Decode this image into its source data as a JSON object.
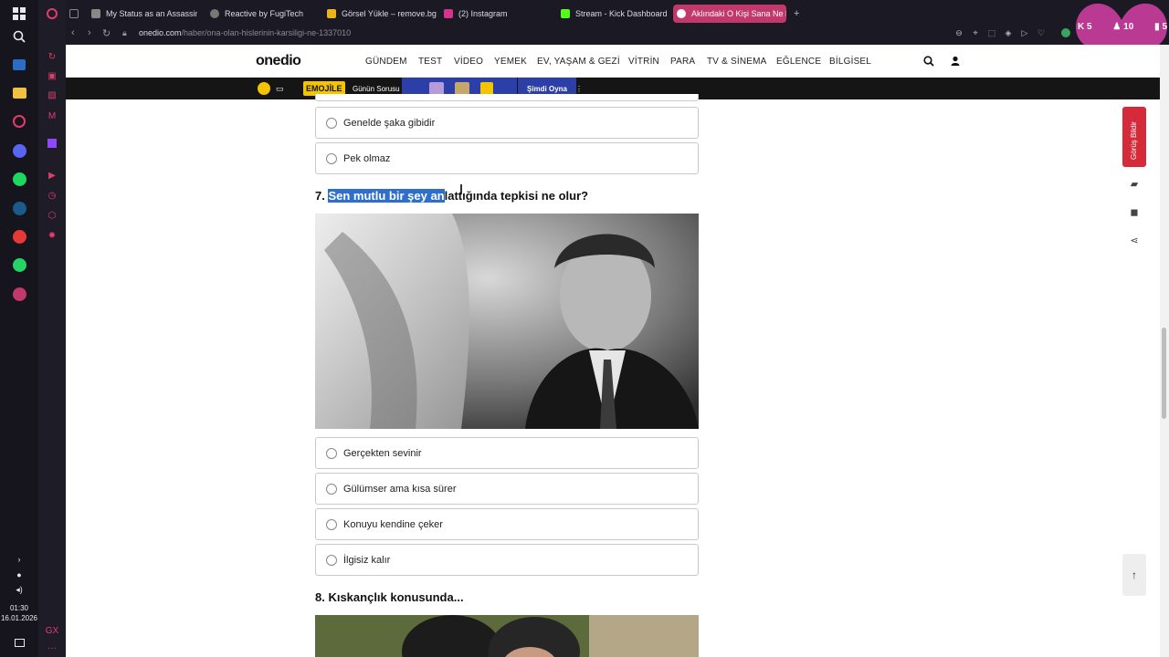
{
  "taskbar": {
    "time": "01:30",
    "date": "16.01.2026",
    "icons": [
      "windows-start",
      "search",
      "steam-shortcut",
      "file-explorer",
      "opera-gx",
      "discord",
      "spotify",
      "steam",
      "app-red",
      "whatsapp",
      "app-gx"
    ]
  },
  "tabs": [
    {
      "title": "My Status as an Assassin",
      "favicon_color": "#888888"
    },
    {
      "title": "Reactive by FugiTech",
      "favicon_color": "#777777"
    },
    {
      "title": "Görsel Yükle – remove.bg",
      "favicon_color": "#e8b31c"
    },
    {
      "title": "(2) Instagram",
      "favicon_color": "#d6338a"
    },
    {
      "title": "Stream - Kick Dashboard",
      "favicon_color": "#53fc18"
    },
    {
      "title": "Aklındaki O Kişi Sana Ne H",
      "favicon_color": "#c2386a",
      "active": true
    }
  ],
  "address": {
    "domain": "onedio.com",
    "path": "/haber/ona-olan-hislerinin-karsiligi-ne-1337010"
  },
  "overlay": {
    "kick_count": "5",
    "viewer_count": "10",
    "stat_count": "5",
    "heart_color": "#d63fa6"
  },
  "site": {
    "logo": "onedio",
    "nav": [
      "GÜNDEM",
      "TEST",
      "VİDEO",
      "YEMEK",
      "EV, YAŞAM & GEZİ",
      "VİTRİN",
      "PARA",
      "TV & SİNEMA",
      "EĞLENCE",
      "BİLGİSEL"
    ],
    "promo": {
      "game": "EMOJİLE",
      "question": "Günün Sorusu",
      "play": "Şimdi Oyna"
    }
  },
  "quiz": {
    "prev_options": [
      "Genelde şaka gibidir",
      "Pek olmaz"
    ],
    "q7": {
      "number": "7.",
      "highlighted": "Sen mutlu bir şey an",
      "rest": "lattığında tepkisi ne olur?",
      "options": [
        "Gerçekten sevinir",
        "Gülümser ama kısa sürer",
        "Konuyu kendine çeker",
        "İlgisiz kalır"
      ]
    },
    "q8": {
      "title": "8. Kıskançlık konusunda..."
    }
  },
  "sidebar": {
    "feedback": "Görüş Bildir"
  }
}
